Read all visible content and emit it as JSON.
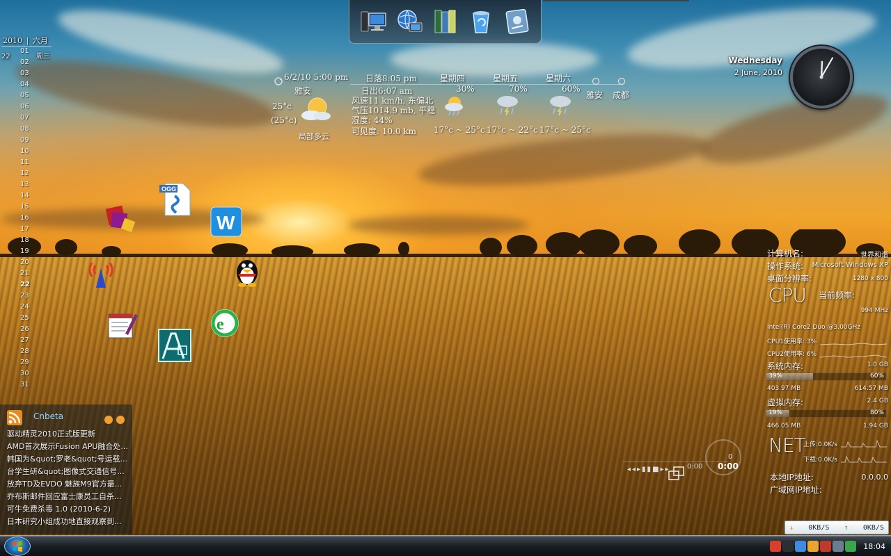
{
  "calendar": {
    "year": "2010",
    "month": "六月",
    "day": "22",
    "weekday_label": "周三",
    "days": [
      "01",
      "02",
      "03",
      "04",
      "05",
      "06",
      "07",
      "08",
      "09",
      "10",
      "11",
      "12",
      "13",
      "14",
      "15",
      "16",
      "17",
      "18",
      "19",
      "20",
      "21",
      "22",
      "23",
      "24",
      "25",
      "26",
      "27",
      "28",
      "29",
      "30",
      "31"
    ]
  },
  "dock": {
    "items": [
      {
        "name": "my-computer-icon"
      },
      {
        "name": "network-icon"
      },
      {
        "name": "library-icon"
      },
      {
        "name": "recycle-bin-icon"
      },
      {
        "name": "control-panel-icon"
      }
    ]
  },
  "weather": {
    "updated": "6/2/10 5:00 pm",
    "location": "雅安",
    "temp_now": "25°c",
    "feels": "(25°c)",
    "condition": "局部多云",
    "sunset": "日落8:05 pm",
    "sunrise": "日出6:07 am",
    "wind": "风速11 km/h, 东偏北",
    "pressure": "气压1014.9 mb, 平稳",
    "humidity": "湿度: 44%",
    "visibility": "可见度: 10.0 km",
    "forecast": [
      {
        "day": "星期四",
        "pct": "30%",
        "range": "17°c ~ 25°c"
      },
      {
        "day": "星期五",
        "pct": "70%",
        "range": "17°c ~ 22°c"
      },
      {
        "day": "星期六",
        "pct": "60%",
        "range": "17°c ~ 25°c"
      }
    ],
    "cities": [
      "雅安",
      "成都"
    ]
  },
  "clock": {
    "weekday": "Wednesday",
    "date": "2 June, 2010",
    "hour": 12,
    "minute": 5
  },
  "desktop_icons": [
    {
      "name": "winrar-icon"
    },
    {
      "name": "ogg-file-icon"
    },
    {
      "name": "word-w-icon"
    },
    {
      "name": "wireless-icon"
    },
    {
      "name": "qq-penguin-icon"
    },
    {
      "name": "notepad-edit-icon"
    },
    {
      "name": "autocad-icon"
    },
    {
      "name": "internet-explorer-icon"
    }
  ],
  "rss": {
    "title": "Cnbeta",
    "items": [
      "驱动精灵2010正式版更新",
      "AMD首次展示Fusion APU融合处...",
      "韩国为&quot;罗老&quot;号运载...",
      "台学生研&quot;图像式交通信号...",
      "放弃TD及EVDO 魅族M9官方最...",
      "乔布斯邮件回应富士康员工自杀...",
      "可牛免费杀毒 1.0 (2010-6-2)",
      "日本研究小组成功地直接观察到..."
    ]
  },
  "player": {
    "elapsed": "0:00",
    "total": "0:00",
    "track": "0"
  },
  "system": {
    "computer_label": "计算机名:",
    "computer_value": "世界和谐",
    "os_label": "操作系统:",
    "os_value": "Microsoft Windows XP",
    "res_label": "桌面分辨率:",
    "res_value": "1280 x 800",
    "cpu_title": "CPU",
    "freq_label": "当前频率:",
    "freq_value": "994 MHz",
    "cpu_model": "Intel(R) Core2 Duo @3.00GHz",
    "cpu1": "CPU1使用率: 3%",
    "cpu2": "CPU2使用率: 6%",
    "mem_label": "系统内存:",
    "mem_total": "1.0 GB",
    "mem_pct_used": "39%",
    "mem_pct_free": "60%",
    "mem_used_fraction": 0.39,
    "mem_used": "403.97 MB",
    "mem_free": "614.57 MB",
    "vmem_label": "虚拟内存:",
    "vmem_total": "2.4 GB",
    "vmem_pct_used": "19%",
    "vmem_pct_free": "80%",
    "vmem_used_fraction": 0.19,
    "vmem_used": "466.05 MB",
    "vmem_free": "1.94 GB",
    "net_title": "NET",
    "upload": "上传:0.0K/s",
    "download": "下载:0.0K/s",
    "lan_ip_label": "本地IP地址:",
    "lan_ip_value": "0.0.0.0",
    "wan_ip_label": "广域网IP地址:"
  },
  "netspeed": {
    "down": "0KB/S",
    "up": "0KB/S"
  },
  "taskbar": {
    "time": "18:04",
    "tray_icons": [
      "sogou-input-icon",
      "arrow-left-icon",
      "network-tray-icon",
      "qq-tray-icon",
      "antivirus-icon",
      "volume-icon",
      "security-shield-icon"
    ]
  }
}
